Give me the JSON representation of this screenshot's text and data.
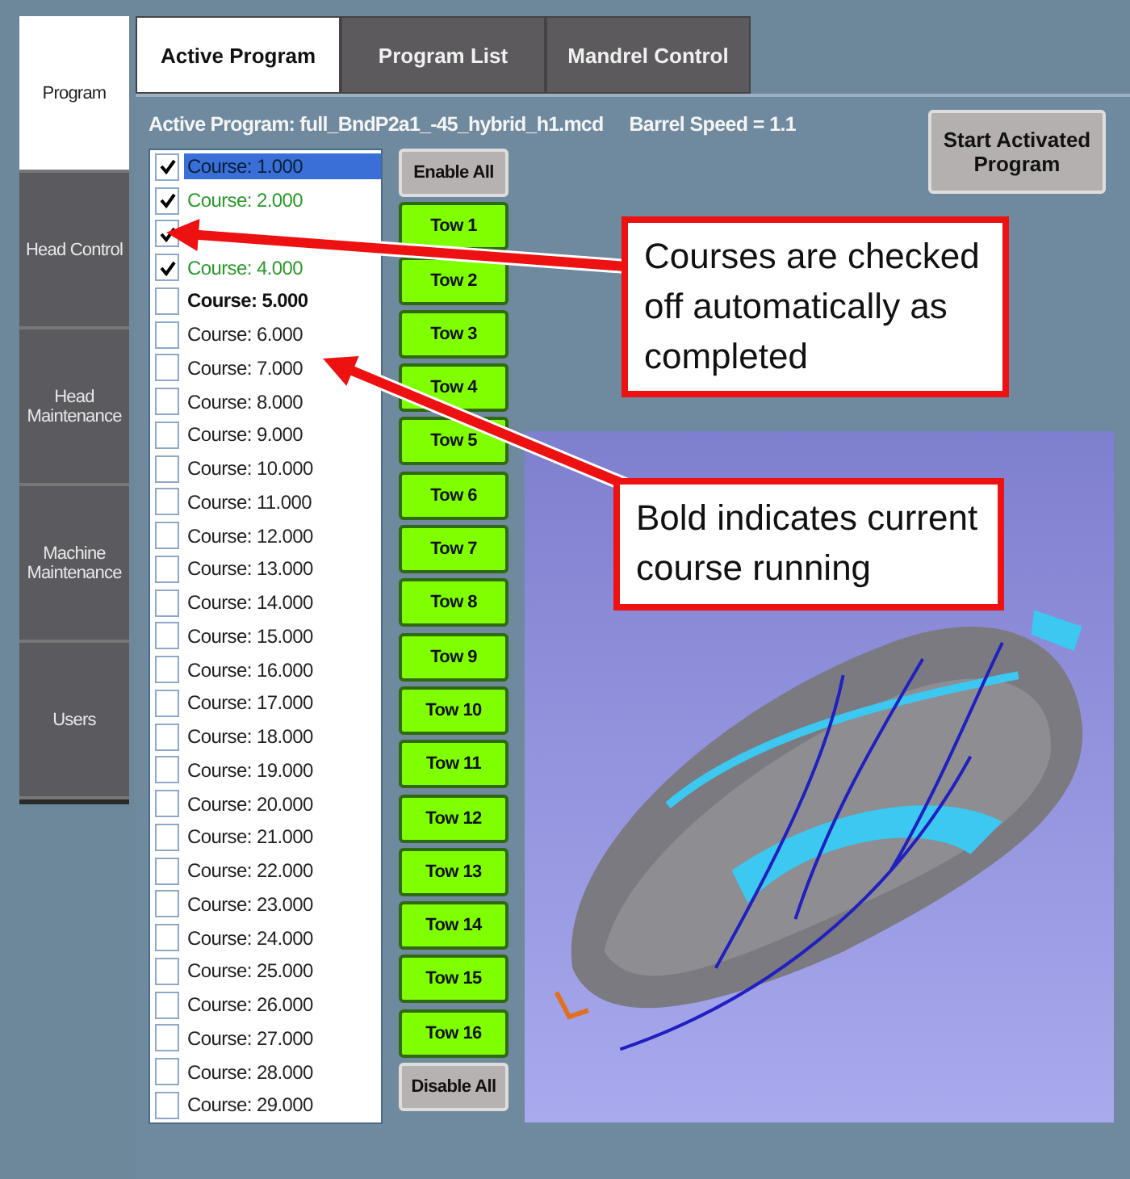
{
  "sidebar": {
    "items": [
      {
        "label": "Program",
        "selected": true
      },
      {
        "label": "Head Control",
        "selected": false
      },
      {
        "label": "Head Maintenance",
        "selected": false
      },
      {
        "label": "Machine Maintenance",
        "selected": false
      },
      {
        "label": "Users",
        "selected": false
      }
    ]
  },
  "tabs": [
    {
      "label": "Active Program",
      "selected": true
    },
    {
      "label": "Program List",
      "selected": false
    },
    {
      "label": "Mandrel Control",
      "selected": false
    }
  ],
  "active_program": "Active Program: full_BndP2a1_-45_hybrid_h1.mcd",
  "barrel_speed": "Barrel Speed = 1.1",
  "start_button": "Start Activated Program",
  "courses": [
    {
      "label": "Course: 1.000",
      "checked": true,
      "completed": true,
      "current": false,
      "selected": true
    },
    {
      "label": "Course: 2.000",
      "checked": true,
      "completed": true,
      "current": false,
      "selected": false
    },
    {
      "checked": true,
      "selected": false
    },
    {
      "label": "Course: 4.000",
      "checked": true,
      "completed": true,
      "current": false,
      "selected": false
    },
    {
      "label": "Course: 5.000",
      "checked": false,
      "completed": false,
      "current": true,
      "selected": false
    },
    {
      "label": "Course: 6.000",
      "checked": false,
      "completed": false,
      "current": false,
      "selected": false
    },
    {
      "label": "Course: 7.000",
      "checked": false,
      "completed": false,
      "current": false,
      "selected": false
    },
    {
      "label": "Course: 8.000",
      "checked": false,
      "completed": false,
      "current": false,
      "selected": false
    },
    {
      "label": "Course: 9.000",
      "checked": false,
      "completed": false,
      "current": false,
      "selected": false
    },
    {
      "label": "Course: 10.000",
      "checked": false,
      "completed": false,
      "current": false,
      "selected": false
    },
    {
      "label": "Course: 11.000",
      "checked": false,
      "completed": false,
      "current": false,
      "selected": false
    },
    {
      "label": "Course: 12.000",
      "checked": false,
      "completed": false,
      "current": false,
      "selected": false
    },
    {
      "label": "Course: 13.000",
      "checked": false,
      "completed": false,
      "current": false,
      "selected": false
    },
    {
      "label": "Course: 14.000",
      "checked": false,
      "completed": false,
      "current": false,
      "selected": false
    },
    {
      "label": "Course: 15.000",
      "checked": false,
      "completed": false,
      "current": false,
      "selected": false
    },
    {
      "label": "Course: 16.000",
      "checked": false,
      "completed": false,
      "current": false,
      "selected": false
    },
    {
      "label": "Course: 17.000",
      "checked": false,
      "completed": false,
      "current": false,
      "selected": false
    },
    {
      "label": "Course: 18.000",
      "checked": false,
      "completed": false,
      "current": false,
      "selected": false
    },
    {
      "label": "Course: 19.000",
      "checked": false,
      "completed": false,
      "current": false,
      "selected": false
    },
    {
      "label": "Course: 20.000",
      "checked": false,
      "completed": false,
      "current": false,
      "selected": false
    },
    {
      "label": "Course: 21.000",
      "checked": false,
      "completed": false,
      "current": false,
      "selected": false
    },
    {
      "label": "Course: 22.000",
      "checked": false,
      "completed": false,
      "current": false,
      "selected": false
    },
    {
      "label": "Course: 23.000",
      "checked": false,
      "completed": false,
      "current": false,
      "selected": false
    },
    {
      "label": "Course: 24.000",
      "checked": false,
      "completed": false,
      "current": false,
      "selected": false
    },
    {
      "label": "Course: 25.000",
      "checked": false,
      "completed": false,
      "current": false,
      "selected": false
    },
    {
      "label": "Course: 26.000",
      "checked": false,
      "completed": false,
      "current": false,
      "selected": false
    },
    {
      "label": "Course: 27.000",
      "checked": false,
      "completed": false,
      "current": false,
      "selected": false
    },
    {
      "label": "Course: 28.000",
      "checked": false,
      "completed": false,
      "current": false,
      "selected": false
    },
    {
      "label": "Course: 29.000",
      "checked": false,
      "completed": false,
      "current": false,
      "selected": false
    }
  ],
  "tow_buttons": [
    {
      "label": "Enable All",
      "kind": "action"
    },
    {
      "label": "Tow 1",
      "kind": "tow"
    },
    {
      "label": "Tow 2",
      "kind": "tow"
    },
    {
      "label": "Tow 3",
      "kind": "tow"
    },
    {
      "label": "Tow 4",
      "kind": "tow"
    },
    {
      "label": "Tow 5",
      "kind": "tow"
    },
    {
      "label": "Tow 6",
      "kind": "tow"
    },
    {
      "label": "Tow 7",
      "kind": "tow"
    },
    {
      "label": "Tow 8",
      "kind": "tow"
    },
    {
      "label": "Tow 9",
      "kind": "tow"
    },
    {
      "label": "Tow 10",
      "kind": "tow"
    },
    {
      "label": "Tow 11",
      "kind": "tow"
    },
    {
      "label": "Tow 12",
      "kind": "tow"
    },
    {
      "label": "Tow 13",
      "kind": "tow"
    },
    {
      "label": "Tow 14",
      "kind": "tow"
    },
    {
      "label": "Tow 15",
      "kind": "tow"
    },
    {
      "label": "Tow 16",
      "kind": "tow"
    },
    {
      "label": "Disable All",
      "kind": "action"
    }
  ],
  "annotations": [
    {
      "text": "Courses are checked off automatically as completed"
    },
    {
      "text": "Bold indicates current course running"
    }
  ]
}
